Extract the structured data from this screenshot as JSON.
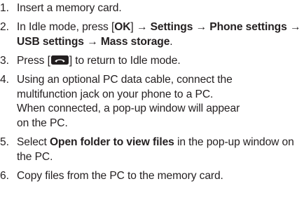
{
  "steps": [
    {
      "number": "1.",
      "text": "Insert a memory card."
    },
    {
      "number": "2.",
      "prefix": "In Idle mode, press [",
      "ok_key": "OK",
      "bracket_close": "]",
      "arrow": " → ",
      "menu_1": "Settings",
      "menu_2": "Phone settings",
      "menu_3": "USB settings",
      "menu_4": "Mass storage",
      "end": "."
    },
    {
      "number": "3.",
      "prefix": "Press [",
      "key_icon": "end-call-key-icon",
      "suffix": "] to return to Idle mode."
    },
    {
      "number": "4.",
      "line_1": "Using an optional PC data cable, connect the",
      "line_2": "multifunction jack on your phone to a PC.",
      "line_3": "When connected, a pop-up window will appear",
      "line_4": "on the PC."
    },
    {
      "number": "5.",
      "prefix": "Select ",
      "option": "Open folder to view files",
      "suffix": " in the pop-up window on the PC."
    },
    {
      "number": "6.",
      "text": "Copy files from the PC to the memory card."
    }
  ]
}
